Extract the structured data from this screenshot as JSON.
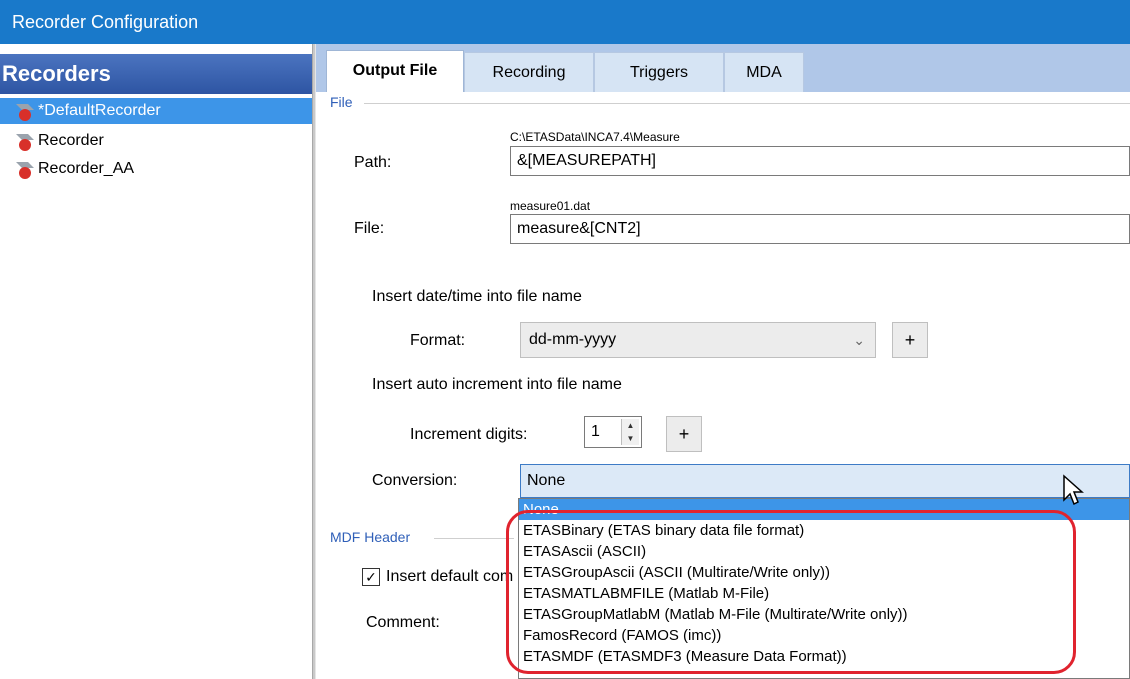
{
  "window": {
    "title": "Recorder Configuration"
  },
  "sidebar": {
    "header": "Recorders",
    "items": [
      {
        "label": "*DefaultRecorder",
        "selected": true
      },
      {
        "label": "Recorder",
        "selected": false
      },
      {
        "label": "Recorder_AA",
        "selected": false
      }
    ]
  },
  "tabs": [
    {
      "label": "Output File",
      "active": true
    },
    {
      "label": "Recording",
      "active": false
    },
    {
      "label": "Triggers",
      "active": false
    },
    {
      "label": "MDA",
      "active": false
    }
  ],
  "file_group": {
    "title": "File",
    "path_label": "Path:",
    "path_preview": "C:\\ETASData\\INCA7.4\\Measure",
    "path_value": "&[MEASUREPATH]",
    "file_label": "File:",
    "file_preview": "measure01.dat",
    "file_value": "measure&[CNT2]",
    "insert_datetime_label": "Insert date/time into file name",
    "format_label": "Format:",
    "format_value": "dd-mm-yyyy",
    "format_plus": "+",
    "insert_increment_label": "Insert auto increment into file name",
    "increment_label": "Increment digits:",
    "increment_value": "1",
    "increment_plus": "+",
    "conversion_label": "Conversion:",
    "conversion_value": "None"
  },
  "conversion_options": [
    "None",
    "ETASBinary (ETAS binary data file format)",
    "ETASAscii (ASCII)",
    "ETASGroupAscii (ASCII (Multirate/Write only))",
    "ETASMATLABMFILE (Matlab M-File)",
    "ETASGroupMatlabM (Matlab M-File (Multirate/Write only))",
    "FamosRecord (FAMOS  (imc))",
    "ETASMDF (ETASMDF3  (Measure Data Format))"
  ],
  "mdf_group": {
    "title": "MDF Header",
    "insert_default_label": "Insert default com",
    "insert_default_checked": true,
    "comment_label": "Comment:"
  },
  "colors": {
    "titlebar": "#1979ca",
    "selection": "#3d95e8",
    "highlight": "#e0232e"
  }
}
